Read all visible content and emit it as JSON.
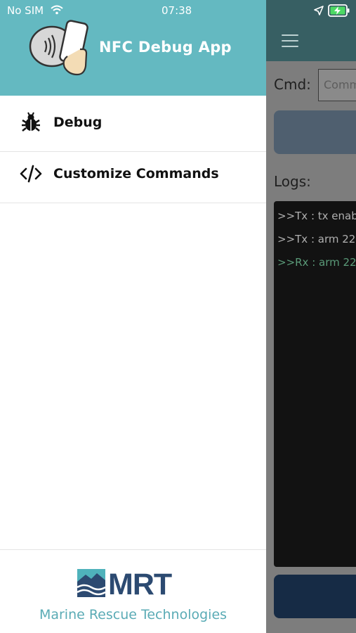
{
  "status_bar": {
    "carrier": "No SIM",
    "time": "07:38",
    "icons": [
      "wifi-icon",
      "location-arrow-icon",
      "battery-charging-icon"
    ]
  },
  "drawer": {
    "app_title": "NFC Debug App",
    "logo_icon": "nfc-phone-tap-icon",
    "items": [
      {
        "label": "Debug",
        "icon": "bug-icon"
      },
      {
        "label": "Customize Commands",
        "icon": "code-brackets-icon"
      }
    ],
    "footer": {
      "brand": "MRT",
      "caption": "Marine Rescue Technologies",
      "brand_color": "#2c4a71",
      "caption_color": "#5aabb5"
    },
    "header_color": "#64b9c1"
  },
  "background_screen": {
    "cmd_label": "Cmd:",
    "cmd_placeholder": "Comm",
    "logs_label": "Logs:",
    "logs": [
      {
        "text": ">>Tx : tx enab",
        "color": "#b0b0b0"
      },
      {
        "text": ">>Tx : arm 22",
        "color": "#b0b0b0"
      },
      {
        "text": ">>Rx : arm 22",
        "color": "#5a9a78"
      }
    ]
  }
}
